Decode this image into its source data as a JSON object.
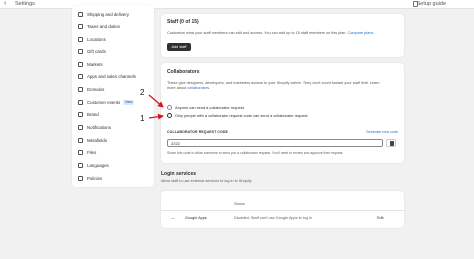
{
  "topbar": {
    "back_glyph": "‹",
    "title": "Settings",
    "guide": "Setup guide"
  },
  "sidebar": {
    "items": [
      {
        "label": "Shipping and delivery",
        "icon": "truck-icon"
      },
      {
        "label": "Taxes and duties",
        "icon": "receipt-icon"
      },
      {
        "label": "Locations",
        "icon": "location-icon"
      },
      {
        "label": "Gift cards",
        "icon": "gift-card-icon"
      },
      {
        "label": "Markets",
        "icon": "globe-icon"
      },
      {
        "label": "Apps and sales channels",
        "icon": "apps-icon"
      },
      {
        "label": "Domains",
        "icon": "globe-icon"
      },
      {
        "label": "Customer events",
        "icon": "cursor-icon",
        "badge": "New"
      },
      {
        "label": "Brand",
        "icon": "brand-icon"
      },
      {
        "label": "Notifications",
        "icon": "bell-icon"
      },
      {
        "label": "Metafields",
        "icon": "metafields-icon"
      },
      {
        "label": "Files",
        "icon": "file-icon"
      },
      {
        "label": "Languages",
        "icon": "language-icon"
      },
      {
        "label": "Policies",
        "icon": "policy-icon"
      }
    ]
  },
  "staff": {
    "title": "Staff (0 of 15)",
    "desc": "Customize what your staff members can edit and access. You can add up to 15 staff members on this plan.",
    "compare_link": "Compare plans.",
    "add_button": "Add staff"
  },
  "collaborators": {
    "title": "Collaborators",
    "desc_line1": "These give designers, developers, and marketers access to your Shopify admin. They don't count toward your staff limit. Learn",
    "desc_line2_prefix": "more about",
    "desc_link": "collaborators.",
    "option_anyone": "Anyone can send a collaborator request",
    "option_code": "Only people with a collaborator request code can send a collaborator request",
    "code_label": "COLLABORATOR REQUEST CODE",
    "generate_link": "Generate new code",
    "code_value": "2222",
    "code_help": "Share this code to allow someone to send you a collaborator request. You'll need to review and approve their request."
  },
  "login": {
    "title": "Login services",
    "subtitle": "Allow staff to use external services to log in to Shopify",
    "col_status": "Status",
    "row_dash": "—",
    "row_service": "Google Apps",
    "row_status": "Disabled: Staff can't use Google Apps to log in",
    "row_edit": "Edit"
  },
  "annotations": {
    "one": "1",
    "two": "2",
    "color": "#e0101a"
  }
}
